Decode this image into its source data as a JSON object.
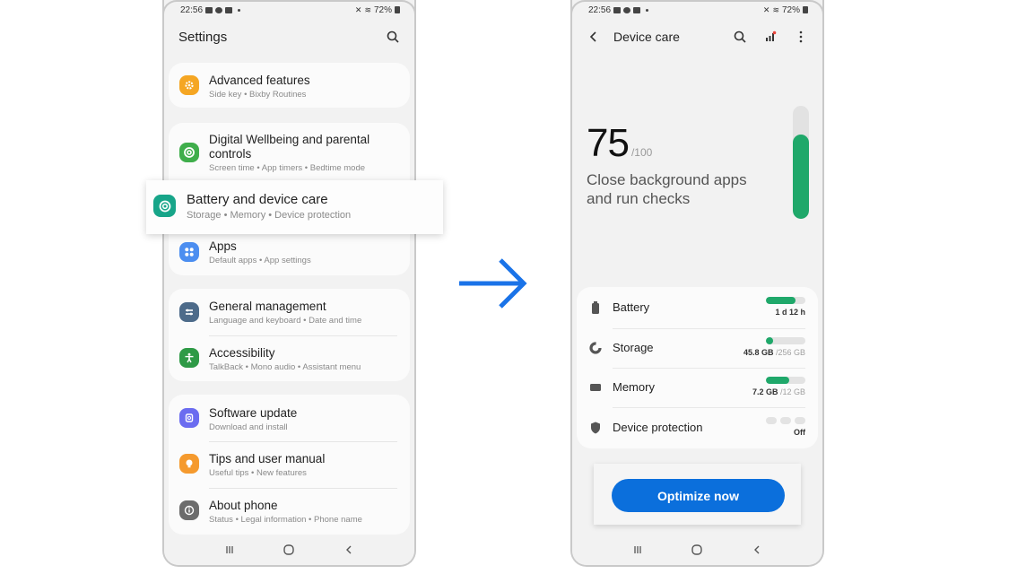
{
  "status_bar": {
    "time": "22:56",
    "battery": "72%"
  },
  "settings": {
    "title": "Settings",
    "items": [
      {
        "title": "Advanced features",
        "subtitle": "Side key  •  Bixby Routines",
        "color": "#f5a623",
        "icon": "gear-icon"
      },
      {
        "title": "Digital Wellbeing and parental controls",
        "subtitle": "Screen time  •  App timers  •  Bedtime mode",
        "color": "#3fae4b",
        "icon": "wellbeing-icon"
      },
      {
        "title": "Battery and device care",
        "subtitle": "Storage  •  Memory  •  Device protection",
        "color": "#17a589",
        "icon": "device-care-icon"
      },
      {
        "title": "Apps",
        "subtitle": "Default apps  •  App settings",
        "color": "#4c8ef0",
        "icon": "apps-icon"
      },
      {
        "title": "General management",
        "subtitle": "Language and keyboard  •  Date and time",
        "color": "#4d6b8a",
        "icon": "sliders-icon"
      },
      {
        "title": "Accessibility",
        "subtitle": "TalkBack  •  Mono audio  •  Assistant menu",
        "color": "#2e9a46",
        "icon": "accessibility-icon"
      },
      {
        "title": "Software update",
        "subtitle": "Download and install",
        "color": "#6b6cf0",
        "icon": "update-icon"
      },
      {
        "title": "Tips and user manual",
        "subtitle": "Useful tips  •  New features",
        "color": "#f59a2e",
        "icon": "lightbulb-icon"
      },
      {
        "title": "About phone",
        "subtitle": "Status  •  Legal information  •  Phone name",
        "color": "#6c6c6c",
        "icon": "info-icon"
      }
    ]
  },
  "device_care": {
    "title": "Device care",
    "score": "75",
    "score_max": "/100",
    "score_fraction": 0.75,
    "message": "Close background apps and run checks",
    "rows": [
      {
        "label": "Battery",
        "value": "1 d 12 h",
        "value_muted": "",
        "fill": 0.75
      },
      {
        "label": "Storage",
        "value": "45.8 GB",
        "value_muted": " /256 GB",
        "fill": 0.18
      },
      {
        "label": "Memory",
        "value": "7.2 GB",
        "value_muted": " /12 GB",
        "fill": 0.6
      },
      {
        "label": "Device protection",
        "value": "Off",
        "value_muted": "",
        "fill": 0
      }
    ],
    "optimize_label": "Optimize now"
  },
  "colors": {
    "accent_blue": "#0b6fdc",
    "progress_green": "#1fa86a",
    "arrow_blue": "#1a73e8"
  }
}
